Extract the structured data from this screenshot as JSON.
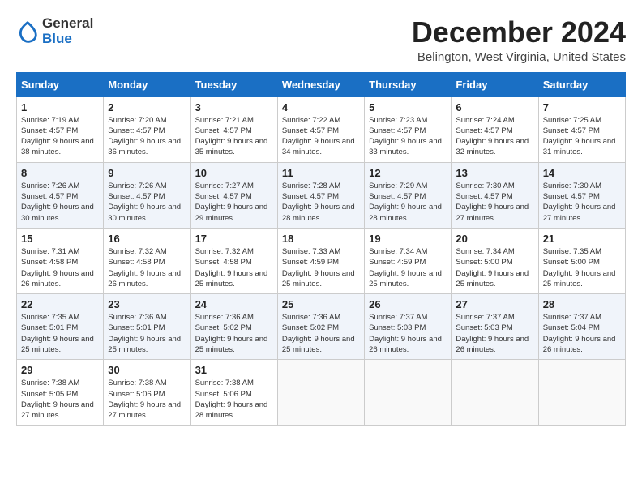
{
  "header": {
    "logo_line1": "General",
    "logo_line2": "Blue",
    "month_title": "December 2024",
    "location": "Belington, West Virginia, United States"
  },
  "calendar": {
    "days_of_week": [
      "Sunday",
      "Monday",
      "Tuesday",
      "Wednesday",
      "Thursday",
      "Friday",
      "Saturday"
    ],
    "weeks": [
      [
        {
          "day": "1",
          "sunrise": "7:19 AM",
          "sunset": "4:57 PM",
          "daylight": "9 hours and 38 minutes."
        },
        {
          "day": "2",
          "sunrise": "7:20 AM",
          "sunset": "4:57 PM",
          "daylight": "9 hours and 36 minutes."
        },
        {
          "day": "3",
          "sunrise": "7:21 AM",
          "sunset": "4:57 PM",
          "daylight": "9 hours and 35 minutes."
        },
        {
          "day": "4",
          "sunrise": "7:22 AM",
          "sunset": "4:57 PM",
          "daylight": "9 hours and 34 minutes."
        },
        {
          "day": "5",
          "sunrise": "7:23 AM",
          "sunset": "4:57 PM",
          "daylight": "9 hours and 33 minutes."
        },
        {
          "day": "6",
          "sunrise": "7:24 AM",
          "sunset": "4:57 PM",
          "daylight": "9 hours and 32 minutes."
        },
        {
          "day": "7",
          "sunrise": "7:25 AM",
          "sunset": "4:57 PM",
          "daylight": "9 hours and 31 minutes."
        }
      ],
      [
        {
          "day": "8",
          "sunrise": "7:26 AM",
          "sunset": "4:57 PM",
          "daylight": "9 hours and 30 minutes."
        },
        {
          "day": "9",
          "sunrise": "7:26 AM",
          "sunset": "4:57 PM",
          "daylight": "9 hours and 30 minutes."
        },
        {
          "day": "10",
          "sunrise": "7:27 AM",
          "sunset": "4:57 PM",
          "daylight": "9 hours and 29 minutes."
        },
        {
          "day": "11",
          "sunrise": "7:28 AM",
          "sunset": "4:57 PM",
          "daylight": "9 hours and 28 minutes."
        },
        {
          "day": "12",
          "sunrise": "7:29 AM",
          "sunset": "4:57 PM",
          "daylight": "9 hours and 28 minutes."
        },
        {
          "day": "13",
          "sunrise": "7:30 AM",
          "sunset": "4:57 PM",
          "daylight": "9 hours and 27 minutes."
        },
        {
          "day": "14",
          "sunrise": "7:30 AM",
          "sunset": "4:57 PM",
          "daylight": "9 hours and 27 minutes."
        }
      ],
      [
        {
          "day": "15",
          "sunrise": "7:31 AM",
          "sunset": "4:58 PM",
          "daylight": "9 hours and 26 minutes."
        },
        {
          "day": "16",
          "sunrise": "7:32 AM",
          "sunset": "4:58 PM",
          "daylight": "9 hours and 26 minutes."
        },
        {
          "day": "17",
          "sunrise": "7:32 AM",
          "sunset": "4:58 PM",
          "daylight": "9 hours and 25 minutes."
        },
        {
          "day": "18",
          "sunrise": "7:33 AM",
          "sunset": "4:59 PM",
          "daylight": "9 hours and 25 minutes."
        },
        {
          "day": "19",
          "sunrise": "7:34 AM",
          "sunset": "4:59 PM",
          "daylight": "9 hours and 25 minutes."
        },
        {
          "day": "20",
          "sunrise": "7:34 AM",
          "sunset": "5:00 PM",
          "daylight": "9 hours and 25 minutes."
        },
        {
          "day": "21",
          "sunrise": "7:35 AM",
          "sunset": "5:00 PM",
          "daylight": "9 hours and 25 minutes."
        }
      ],
      [
        {
          "day": "22",
          "sunrise": "7:35 AM",
          "sunset": "5:01 PM",
          "daylight": "9 hours and 25 minutes."
        },
        {
          "day": "23",
          "sunrise": "7:36 AM",
          "sunset": "5:01 PM",
          "daylight": "9 hours and 25 minutes."
        },
        {
          "day": "24",
          "sunrise": "7:36 AM",
          "sunset": "5:02 PM",
          "daylight": "9 hours and 25 minutes."
        },
        {
          "day": "25",
          "sunrise": "7:36 AM",
          "sunset": "5:02 PM",
          "daylight": "9 hours and 25 minutes."
        },
        {
          "day": "26",
          "sunrise": "7:37 AM",
          "sunset": "5:03 PM",
          "daylight": "9 hours and 26 minutes."
        },
        {
          "day": "27",
          "sunrise": "7:37 AM",
          "sunset": "5:03 PM",
          "daylight": "9 hours and 26 minutes."
        },
        {
          "day": "28",
          "sunrise": "7:37 AM",
          "sunset": "5:04 PM",
          "daylight": "9 hours and 26 minutes."
        }
      ],
      [
        {
          "day": "29",
          "sunrise": "7:38 AM",
          "sunset": "5:05 PM",
          "daylight": "9 hours and 27 minutes."
        },
        {
          "day": "30",
          "sunrise": "7:38 AM",
          "sunset": "5:06 PM",
          "daylight": "9 hours and 27 minutes."
        },
        {
          "day": "31",
          "sunrise": "7:38 AM",
          "sunset": "5:06 PM",
          "daylight": "9 hours and 28 minutes."
        },
        null,
        null,
        null,
        null
      ]
    ]
  }
}
